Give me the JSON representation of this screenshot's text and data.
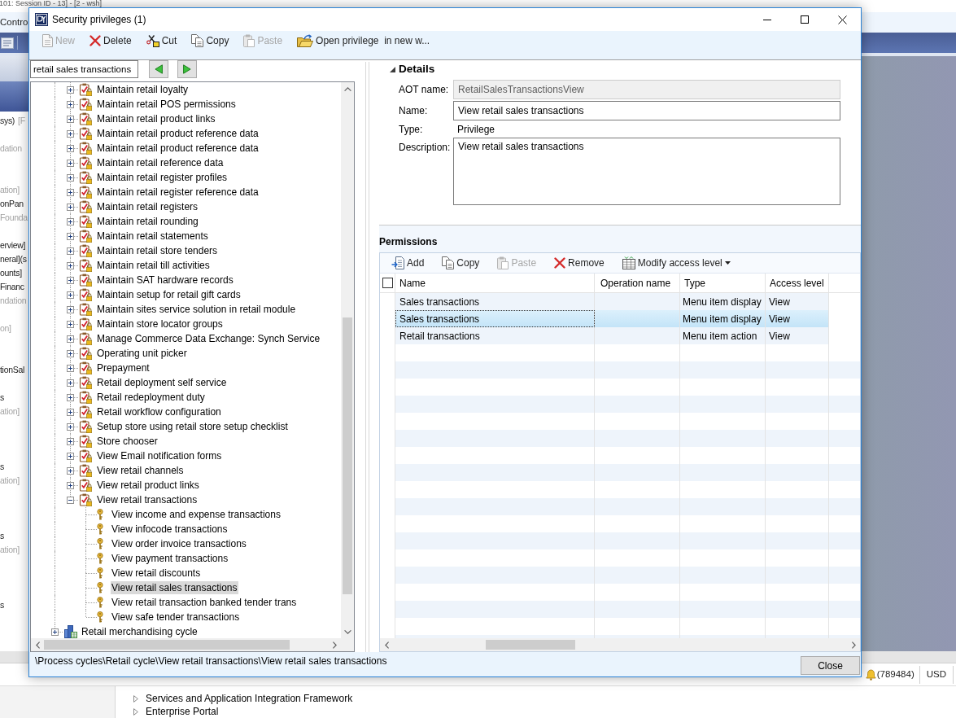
{
  "background_app": {
    "title": "101: Session ID - 13] - [2 - wsh]",
    "nav_label": "Contro",
    "side_list": [
      {
        "parts": [
          {
            "text": "sys)",
            "dimmed": false
          },
          {
            "text": "[F",
            "dimmed": true
          }
        ]
      },
      {
        "parts": [
          {
            "text": "dation",
            "dimmed": true
          }
        ]
      },
      {
        "parts": [
          {
            "text": "ation]",
            "dimmed": true
          }
        ]
      },
      {
        "parts": [
          {
            "text": "onPan",
            "dimmed": false
          }
        ]
      },
      {
        "parts": [
          {
            "text": "Founda",
            "dimmed": true
          }
        ]
      },
      {
        "parts": [
          {
            "text": "erview]",
            "dimmed": false
          }
        ]
      },
      {
        "parts": [
          {
            "text": "neral](s",
            "dimmed": false
          }
        ]
      },
      {
        "parts": [
          {
            "text": "ounts]",
            "dimmed": false
          }
        ]
      },
      {
        "parts": [
          {
            "text": "Financ",
            "dimmed": false
          }
        ]
      },
      {
        "parts": [
          {
            "text": "ndation",
            "dimmed": true
          }
        ]
      },
      {
        "parts": [
          {
            "text": "on]",
            "dimmed": true
          }
        ]
      },
      {
        "parts": [
          {
            "text": "tionSal",
            "dimmed": false
          }
        ]
      },
      {
        "parts": [
          {
            "text": "s",
            "dimmed": false
          }
        ]
      },
      {
        "parts": [
          {
            "text": "ation]",
            "dimmed": true
          }
        ]
      },
      {
        "parts": [
          {
            "text": "s",
            "dimmed": false
          }
        ]
      },
      {
        "parts": [
          {
            "text": "ation]",
            "dimmed": true
          }
        ]
      },
      {
        "parts": [
          {
            "text": "s",
            "dimmed": false
          }
        ]
      },
      {
        "parts": [
          {
            "text": "ation]",
            "dimmed": true
          }
        ]
      },
      {
        "parts": [
          {
            "text": "s",
            "dimmed": false
          }
        ]
      }
    ],
    "status_bar": {
      "notifications": "(789484)",
      "currency": "USD"
    },
    "tree": [
      {
        "label": "Services and Application Integration Framework",
        "expanded": false,
        "selected": false
      },
      {
        "label": "Enterprise Portal",
        "expanded": false,
        "selected": false
      }
    ]
  },
  "dialog": {
    "title": "Security privileges (1)",
    "toolbar": [
      {
        "kind": "new",
        "label": "New",
        "disabled": true
      },
      {
        "kind": "delete",
        "label": "Delete",
        "disabled": false
      },
      {
        "kind": "cut",
        "label": "Cut",
        "disabled": false
      },
      {
        "kind": "copy",
        "label": "Copy",
        "disabled": false
      },
      {
        "kind": "paste",
        "label": "Paste",
        "disabled": true
      },
      {
        "kind": "open",
        "label": "Open privilege  in new w...",
        "disabled": false
      }
    ],
    "search": {
      "value": "retail sales transactions"
    },
    "tree": {
      "items": [
        {
          "children": [
            {
              "kind": "privilege",
              "label": "Maintain retail loyalty",
              "expanded": false,
              "selected": false
            },
            {
              "kind": "privilege",
              "label": "Maintain retail POS permissions",
              "expanded": false,
              "selected": false
            },
            {
              "kind": "privilege",
              "label": "Maintain retail product links",
              "expanded": false,
              "selected": false
            },
            {
              "kind": "privilege",
              "label": "Maintain retail product reference data",
              "expanded": false,
              "selected": false
            },
            {
              "kind": "privilege",
              "label": "Maintain retail product reference data",
              "expanded": false,
              "selected": false
            },
            {
              "kind": "privilege",
              "label": "Maintain retail reference data",
              "expanded": false,
              "selected": false
            },
            {
              "kind": "privilege",
              "label": "Maintain retail register profiles",
              "expanded": false,
              "selected": false
            },
            {
              "kind": "privilege",
              "label": "Maintain retail register reference data",
              "expanded": false,
              "selected": false
            },
            {
              "kind": "privilege",
              "label": "Maintain retail registers",
              "expanded": false,
              "selected": false
            },
            {
              "kind": "privilege",
              "label": "Maintain retail rounding",
              "expanded": false,
              "selected": false
            },
            {
              "kind": "privilege",
              "label": "Maintain retail statements",
              "expanded": false,
              "selected": false
            },
            {
              "kind": "privilege",
              "label": "Maintain retail store tenders",
              "expanded": false,
              "selected": false
            },
            {
              "kind": "privilege",
              "label": "Maintain retail till activities",
              "expanded": false,
              "selected": false
            },
            {
              "kind": "privilege",
              "label": "Maintain SAT hardware records",
              "expanded": false,
              "selected": false
            },
            {
              "kind": "privilege",
              "label": "Maintain setup for retail gift cards",
              "expanded": false,
              "selected": false
            },
            {
              "kind": "privilege",
              "label": "Maintain sites service solution in retail module",
              "expanded": false,
              "selected": false
            },
            {
              "kind": "privilege",
              "label": "Maintain store locator groups",
              "expanded": false,
              "selected": false
            },
            {
              "kind": "privilege",
              "label": "Manage Commerce Data Exchange: Synch Service",
              "expanded": false,
              "selected": false
            },
            {
              "kind": "privilege",
              "label": "Operating unit picker",
              "expanded": false,
              "selected": false
            },
            {
              "kind": "privilege",
              "label": "Prepayment",
              "expanded": false,
              "selected": false
            },
            {
              "kind": "privilege",
              "label": "Retail deployment self service",
              "expanded": false,
              "selected": false
            },
            {
              "kind": "privilege",
              "label": "Retail redeployment duty",
              "expanded": false,
              "selected": false
            },
            {
              "kind": "privilege",
              "label": "Retail workflow configuration",
              "expanded": false,
              "selected": false
            },
            {
              "kind": "privilege",
              "label": "Setup store using retail store setup checklist",
              "expanded": false,
              "selected": false
            },
            {
              "kind": "privilege",
              "label": "Store chooser",
              "expanded": false,
              "selected": false
            },
            {
              "kind": "privilege",
              "label": "View Email notification forms",
              "expanded": false,
              "selected": false
            },
            {
              "kind": "privilege",
              "label": "View retail channels",
              "expanded": false,
              "selected": false
            },
            {
              "kind": "privilege",
              "label": "View retail product links",
              "expanded": false,
              "selected": false
            },
            {
              "kind": "privilege",
              "label": "View retail transactions",
              "expanded": true,
              "selected": false,
              "children": [
                {
                  "kind": "key",
                  "label": "View income and expense transactions",
                  "selected": false
                },
                {
                  "kind": "key",
                  "label": "View infocode transactions",
                  "selected": false
                },
                {
                  "kind": "key",
                  "label": "View order invoice transactions",
                  "selected": false
                },
                {
                  "kind": "key",
                  "label": "View payment transactions",
                  "selected": false
                },
                {
                  "kind": "key",
                  "label": "View retail discounts",
                  "selected": false
                },
                {
                  "kind": "key",
                  "label": "View retail sales transactions",
                  "selected": true
                },
                {
                  "kind": "key",
                  "label": "View retail transaction banked tender trans",
                  "selected": false
                },
                {
                  "kind": "key",
                  "label": "View safe tender transactions",
                  "selected": false
                }
              ]
            }
          ]
        },
        {
          "kind": "cycle",
          "label": "Retail merchandising cycle",
          "expanded": false,
          "selected": false
        }
      ]
    },
    "details": {
      "title": "Details",
      "expanded": true,
      "fields": [
        {
          "kind": "input",
          "label": "AOT name:",
          "value": "RetailSalesTransactionsView",
          "disabled": true
        },
        {
          "kind": "input",
          "label": "Name:",
          "value": "View retail sales transactions",
          "disabled": false
        },
        {
          "kind": "text",
          "label": "Type:",
          "value": "Privilege"
        },
        {
          "kind": "textarea",
          "label": "Description:",
          "value": "View retail sales transactions",
          "disabled": false
        }
      ]
    },
    "permissions": {
      "title": "Permissions",
      "toolbar": [
        {
          "kind": "add",
          "label": "Add",
          "disabled": false
        },
        {
          "kind": "copy",
          "label": "Copy",
          "disabled": false
        },
        {
          "kind": "paste",
          "label": "Paste",
          "disabled": true
        },
        {
          "kind": "remove",
          "label": "Remove",
          "disabled": false
        },
        {
          "kind": "modify",
          "label": "Modify access level",
          "disabled": false
        }
      ],
      "select_all_checked": false,
      "columns": [
        "Name",
        "Operation name",
        "Type",
        "Access level"
      ],
      "rows": [
        {
          "name": "Sales transactions",
          "type": "Menu item display",
          "access_level": "View",
          "selected": false
        },
        {
          "name": "Sales transactions",
          "type": "Menu item display",
          "access_level": "View",
          "selected": true
        },
        {
          "name": "Retail transactions",
          "type": "Menu item action",
          "access_level": "View",
          "selected": false
        }
      ]
    },
    "path": "\\Process cycles\\Retail cycle\\View retail transactions\\View retail sales transactions",
    "close_button": "Close"
  }
}
